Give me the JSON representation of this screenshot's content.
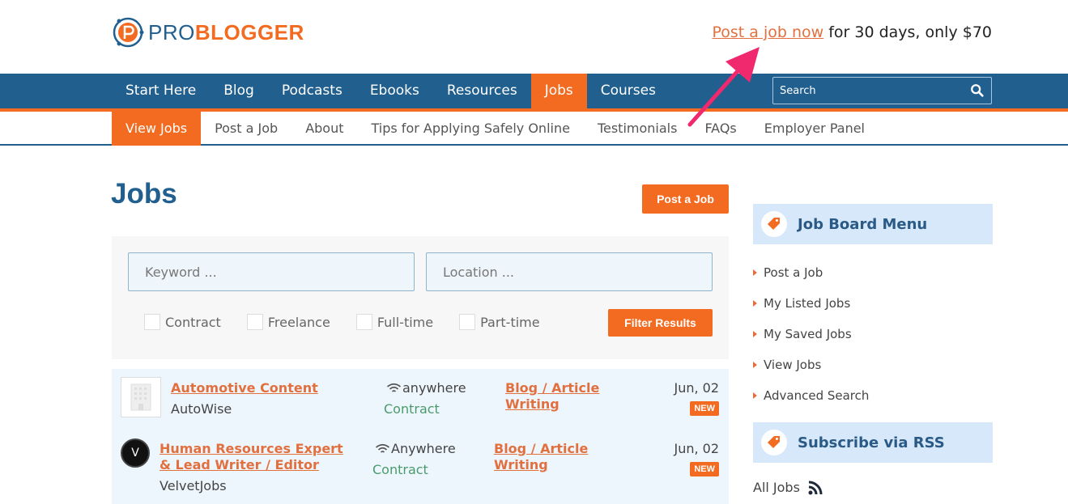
{
  "header": {
    "logo": {
      "pro": "PRO",
      "blogger": "BLOGGER"
    },
    "promo": {
      "link": "Post a job now",
      "text": " for 30 days, only $70"
    }
  },
  "nav": {
    "items": [
      {
        "label": "Start Here",
        "active": false
      },
      {
        "label": "Blog",
        "active": false
      },
      {
        "label": "Podcasts",
        "active": false
      },
      {
        "label": "Ebooks",
        "active": false
      },
      {
        "label": "Resources",
        "active": false
      },
      {
        "label": "Jobs",
        "active": true
      },
      {
        "label": "Courses",
        "active": false
      }
    ],
    "search_placeholder": "Search"
  },
  "subnav": {
    "items": [
      {
        "label": "View Jobs",
        "active": true
      },
      {
        "label": "Post a Job",
        "active": false
      },
      {
        "label": "About",
        "active": false
      },
      {
        "label": "Tips for Applying Safely Online",
        "active": false
      },
      {
        "label": "Testimonials",
        "active": false
      },
      {
        "label": "FAQs",
        "active": false
      },
      {
        "label": "Employer Panel",
        "active": false
      }
    ]
  },
  "main": {
    "title": "Jobs",
    "post_job_label": "Post a Job",
    "filters": {
      "keyword_placeholder": "Keyword ...",
      "location_placeholder": "Location ...",
      "job_types": [
        "Contract",
        "Freelance",
        "Full-time",
        "Part-time"
      ],
      "submit_label": "Filter Results"
    },
    "jobs": [
      {
        "title": "Automotive Content",
        "company": "AutoWise",
        "location": "anywhere",
        "type": "Contract",
        "category": "Blog / Article Writing",
        "date": "Jun, 02",
        "badge": "NEW",
        "logo": "building-placeholder"
      },
      {
        "title": "Human Resources Expert & Lead Writer / Editor",
        "company": "VelvetJobs",
        "location": "Anywhere",
        "type": "Contract",
        "category": "Blog / Article Writing",
        "date": "Jun, 02",
        "badge": "NEW",
        "logo": "V"
      }
    ]
  },
  "sidebar": {
    "job_board_menu": {
      "title": "Job Board Menu",
      "items": [
        "Post a Job",
        "My Listed Jobs",
        "My Saved Jobs",
        "View Jobs",
        "Advanced Search"
      ]
    },
    "rss": {
      "title": "Subscribe via RSS",
      "link": "All Jobs"
    }
  },
  "colors": {
    "brand_blue": "#215f8f",
    "brand_orange": "#f26b21",
    "link_orange": "#e2703f",
    "contract_green": "#4b9a6b",
    "annotation_arrow": "#f0286e"
  }
}
